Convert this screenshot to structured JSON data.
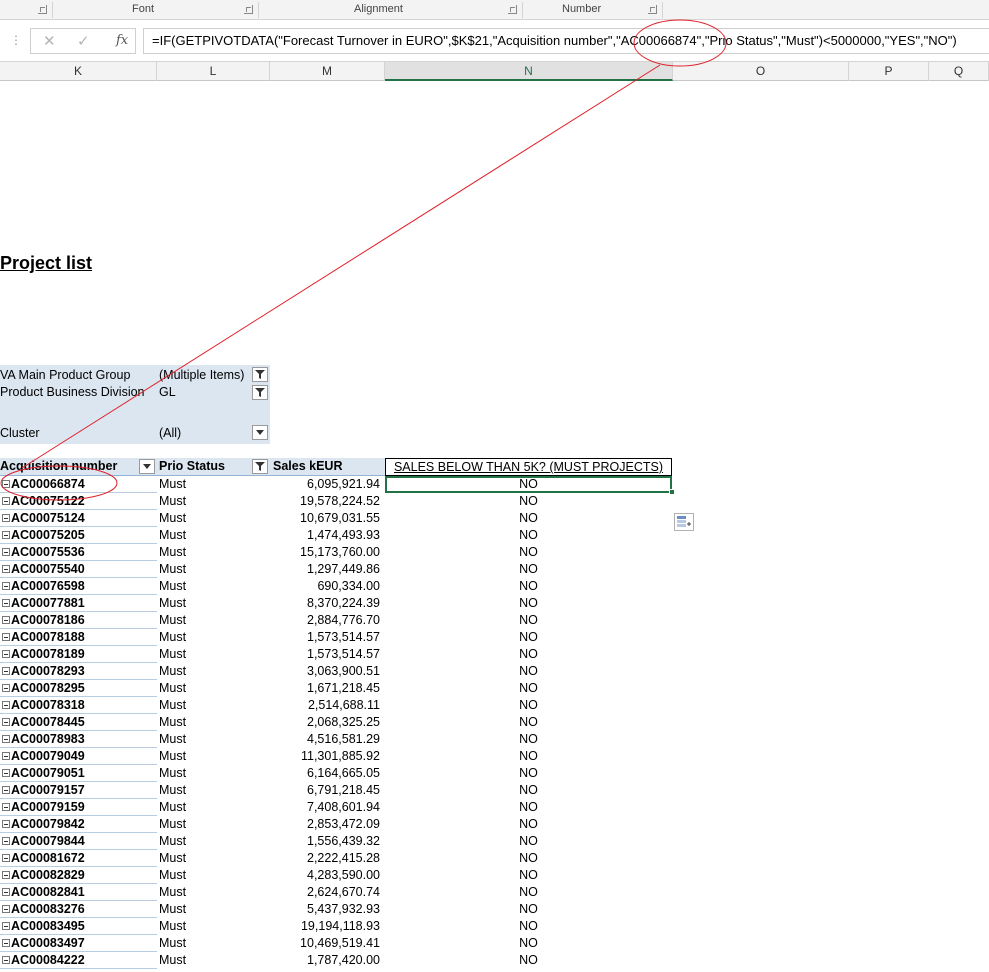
{
  "ribbon_groups": [
    "Font",
    "Alignment",
    "Number"
  ],
  "formula_bar": {
    "fx_symbol": "fx",
    "cancel_symbol": "✕",
    "enter_symbol": "✓",
    "formula": "=IF(GETPIVOTDATA(\"Forecast Turnover in EURO\",$K$21,\"Acquisition number\",\"AC00066874\",\"Prio Status\",\"Must\")<5000000,\"YES\",\"NO\")"
  },
  "columns": [
    "K",
    "L",
    "M",
    "N",
    "O",
    "P",
    "Q"
  ],
  "active_column": "N",
  "sheet": {
    "title": "Project list",
    "filters": [
      {
        "label": "VA Main Product Group",
        "value": "(Multiple Items)"
      },
      {
        "label": "Product Business Division",
        "value": "GL"
      },
      {
        "label": "Cluster",
        "value": "(All)"
      }
    ],
    "pivot_headers": {
      "acquisition": "Acquisition number",
      "prio": "Prio Status",
      "sales": "Sales kEUR",
      "below": "SALES BELOW THAN 5K? (MUST PROJECTS)"
    },
    "rows": [
      {
        "acq": "AC00066874",
        "prio": "Must",
        "sales": "6,095,921.94",
        "below": "NO"
      },
      {
        "acq": "AC00075122",
        "prio": "Must",
        "sales": "19,578,224.52",
        "below": "NO"
      },
      {
        "acq": "AC00075124",
        "prio": "Must",
        "sales": "10,679,031.55",
        "below": "NO"
      },
      {
        "acq": "AC00075205",
        "prio": "Must",
        "sales": "1,474,493.93",
        "below": "NO"
      },
      {
        "acq": "AC00075536",
        "prio": "Must",
        "sales": "15,173,760.00",
        "below": "NO"
      },
      {
        "acq": "AC00075540",
        "prio": "Must",
        "sales": "1,297,449.86",
        "below": "NO"
      },
      {
        "acq": "AC00076598",
        "prio": "Must",
        "sales": "690,334.00",
        "below": "NO"
      },
      {
        "acq": "AC00077881",
        "prio": "Must",
        "sales": "8,370,224.39",
        "below": "NO"
      },
      {
        "acq": "AC00078186",
        "prio": "Must",
        "sales": "2,884,776.70",
        "below": "NO"
      },
      {
        "acq": "AC00078188",
        "prio": "Must",
        "sales": "1,573,514.57",
        "below": "NO"
      },
      {
        "acq": "AC00078189",
        "prio": "Must",
        "sales": "1,573,514.57",
        "below": "NO"
      },
      {
        "acq": "AC00078293",
        "prio": "Must",
        "sales": "3,063,900.51",
        "below": "NO"
      },
      {
        "acq": "AC00078295",
        "prio": "Must",
        "sales": "1,671,218.45",
        "below": "NO"
      },
      {
        "acq": "AC00078318",
        "prio": "Must",
        "sales": "2,514,688.11",
        "below": "NO"
      },
      {
        "acq": "AC00078445",
        "prio": "Must",
        "sales": "2,068,325.25",
        "below": "NO"
      },
      {
        "acq": "AC00078983",
        "prio": "Must",
        "sales": "4,516,581.29",
        "below": "NO"
      },
      {
        "acq": "AC00079049",
        "prio": "Must",
        "sales": "11,301,885.92",
        "below": "NO"
      },
      {
        "acq": "AC00079051",
        "prio": "Must",
        "sales": "6,164,665.05",
        "below": "NO"
      },
      {
        "acq": "AC00079157",
        "prio": "Must",
        "sales": "6,791,218.45",
        "below": "NO"
      },
      {
        "acq": "AC00079159",
        "prio": "Must",
        "sales": "7,408,601.94",
        "below": "NO"
      },
      {
        "acq": "AC00079842",
        "prio": "Must",
        "sales": "2,853,472.09",
        "below": "NO"
      },
      {
        "acq": "AC00079844",
        "prio": "Must",
        "sales": "1,556,439.32",
        "below": "NO"
      },
      {
        "acq": "AC00081672",
        "prio": "Must",
        "sales": "2,222,415.28",
        "below": "NO"
      },
      {
        "acq": "AC00082829",
        "prio": "Must",
        "sales": "4,283,590.00",
        "below": "NO"
      },
      {
        "acq": "AC00082841",
        "prio": "Must",
        "sales": "2,624,670.74",
        "below": "NO"
      },
      {
        "acq": "AC00083276",
        "prio": "Must",
        "sales": "5,437,932.93",
        "below": "NO"
      },
      {
        "acq": "AC00083495",
        "prio": "Must",
        "sales": "19,194,118.93",
        "below": "NO"
      },
      {
        "acq": "AC00083497",
        "prio": "Must",
        "sales": "10,469,519.41",
        "below": "NO"
      },
      {
        "acq": "AC00084222",
        "prio": "Must",
        "sales": "1,787,420.00",
        "below": "NO"
      }
    ]
  },
  "colors": {
    "pivot_fill": "#dce6f1",
    "selection_green": "#217346",
    "annotation_red": "#e0202a"
  },
  "icons": [
    "filter-icon",
    "collapse-icon",
    "paste-options-icon"
  ]
}
